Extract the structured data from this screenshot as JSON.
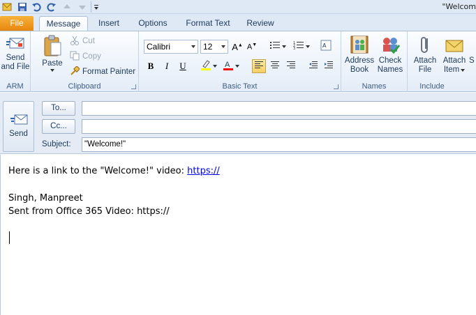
{
  "window": {
    "title": "\"Welcom"
  },
  "quick_access": {
    "icons": [
      "outlook-icon",
      "save-icon",
      "undo-icon",
      "redo-icon",
      "arrow-up-icon",
      "arrow-down-icon",
      "customize-icon"
    ]
  },
  "tabs": [
    {
      "label": "File",
      "active": false
    },
    {
      "label": "Message",
      "active": true
    },
    {
      "label": "Insert",
      "active": false
    },
    {
      "label": "Options",
      "active": false
    },
    {
      "label": "Format Text",
      "active": false
    },
    {
      "label": "Review",
      "active": false
    }
  ],
  "ribbon": {
    "arm": {
      "button_line1": "Send",
      "button_line2": "and File",
      "group_label": "ARM"
    },
    "clipboard": {
      "paste": "Paste",
      "cut": "Cut",
      "copy": "Copy",
      "format_painter": "Format Painter",
      "group_label": "Clipboard"
    },
    "basic_text": {
      "font": "Calibri",
      "size": "12",
      "bold": "B",
      "italic": "I",
      "underline": "U",
      "group_label": "Basic Text"
    },
    "names": {
      "address_line1": "Address",
      "address_line2": "Book",
      "check_line1": "Check",
      "check_line2": "Names",
      "group_label": "Names"
    },
    "include": {
      "attach_file_line1": "Attach",
      "attach_file_line2": "File",
      "attach_item_line1": "Attach",
      "attach_item_line2": "Item",
      "partial": "S",
      "group_label": "Include"
    }
  },
  "compose": {
    "send_label": "Send",
    "to_label": "To...",
    "cc_label": "Cc...",
    "subject_label": "Subject:",
    "to_value": "",
    "cc_value": "",
    "subject_value": "\"Welcome!\""
  },
  "message_body": {
    "line1_prefix": "Here is a link to the \"Welcome!\" video: ",
    "line1_link": "https://",
    "signature_name": "Singh, Manpreet",
    "signature_sent": "Sent from Office 365 Video: https://"
  },
  "colors": {
    "file_tab": "#e8860e",
    "ribbon_bg": "#e3ecf7",
    "highlight": "#ffff00",
    "font_color": "#ff0000",
    "link": "#0000ee"
  }
}
